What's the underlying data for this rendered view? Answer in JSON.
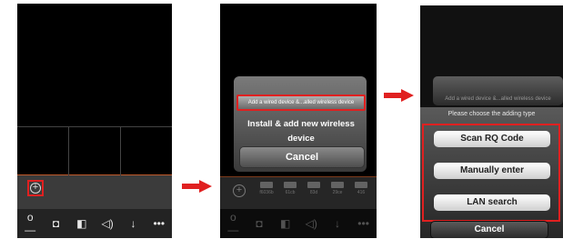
{
  "screen1": {
    "channel_bar": {
      "add_icon": "add-circle-icon"
    },
    "toolbar": [
      "key-icon",
      "camera-icon",
      "record-icon",
      "speaker-icon",
      "mic-icon",
      "more-icon"
    ]
  },
  "screen2": {
    "sheet": {
      "option_wired": "Add a wired device &...alled wireless device",
      "option_install": "Install & add new wireless device",
      "cancel": "Cancel"
    },
    "channels": [
      "f6036b",
      "61cb",
      "83d",
      "29ce",
      "416"
    ]
  },
  "screen3": {
    "ghost_option": "Add a wired device &...alled wireless device",
    "prompt": "Please choose the adding type",
    "buttons": {
      "scan": "Scan RQ Code",
      "manual": "Manually enter",
      "lan": "LAN search"
    },
    "cancel": "Cancel"
  },
  "colors": {
    "highlight": "#e02020",
    "background": "#000000"
  }
}
